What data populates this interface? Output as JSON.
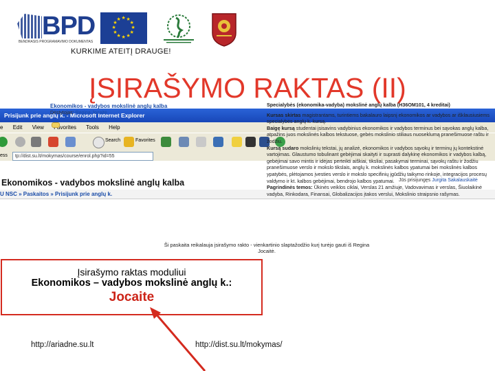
{
  "logos": {
    "bpd_text": "BPD",
    "bpd_subtitle": "BENDRASIS PROGRAMAVIMO DOKUMENTAS",
    "eu_name": "eu-flag",
    "esf_name": "esf-logo",
    "university_name": "university-crest"
  },
  "colors": {
    "title": "#e2382a",
    "callout_border": "#d42a1e",
    "link": "#1a4ca8",
    "xp_title": "#2a63d7"
  },
  "motto": "KURKIME   ATEITĮ   DRAUGE!",
  "title": "ĮSIRAŠYMO RAKTAS (II)",
  "browser": {
    "window_title": "Prisijunk prie anglų k. - Microsoft Internet Explorer",
    "menu": [
      "e",
      "Edit",
      "View",
      "Favorites",
      "Tools",
      "Help"
    ],
    "toolbar": {
      "search_label": "Search",
      "favorites_label": "Favorites"
    },
    "address": "tp://dist.su.lt/mokymas/course/enrol.php?id=55",
    "address_label": "ess",
    "page_heading": "Ekonomikos - vadybos mokslinė anglų kalba",
    "login_text": "Jūs prisijungęs",
    "login_user": "Jurgita Sakalauskaitė",
    "breadcrumbs": "U NSC » Paskaitos » Prisijunk prie anglų k.",
    "course_title": "Ekonomikos - vadybos mokslinė anglų kalba",
    "lecturer_label": "Dėstytojas:",
    "lecturer_name": "Regina Jocaitė",
    "description": {
      "heading": "Specialybės (ekonomika-vadyba) mokslinė anglų kalba (H36OM101, 4 kreditai)",
      "p1_label": "Kursas skirtas",
      "p1": "magistrantams, turintiems bakalauro laipsnį ekonomikos ar vadybos ar išklausiusiems specialybės anglų k. kursą.",
      "p2_label": "Baigę kursą",
      "p2": "studentai įsisavins vadybinius ekonomikos ir vadybos terminus bei sąvokas anglų kalba, atpažins juos mokslinės kalbos tekstuose, gebės mokslinio stiliaus nuoseklumą pranešimuose raštu ir žodžiu.",
      "p3_label": "Kursą sudaro",
      "p3": "mokslinių tekstai, jų analizė, ekonomikos ir vadybos sąvokų ir terminų jų kontekstinė vartojimas. Glaustumo tobulinant gebėjimai skaityti ir suprasti dalykinę ekonomikos ir vadybos kalbą, gebėjimai savo mintis ir idėjas perteikti aiškiai, tiksliai, pasakymai terminai, sąvokų raštu ir žodžiu pranešimuose verslo ir mokslo tikslais, anglų k. mokslinės kalbos ypatumai bei mokslinės kalbos ypatybės, plėtojamos įvesties verslo ir mokslo specifinių įgūdžių taikymo rinkoje, integracijos procesų valdymo ir kt. kalbos gebėjimai, bendrojo kalbos ypatumai.",
      "p4_label": "Pagrindinės temos:",
      "p4": "Ūkinės veiklos ciklai, Verslas 21 amžiuje, Vadovavimas ir verslas, Šiuolaikinė vadyba, Rinkodara, Finansai, Globalizacijos įtakos verslui, Mokslinio straipsnio rašymas."
    },
    "notice": "Ši paskaita reikalauja įsirašymo rakto - vienkartinio slaptažodžio kurį turėjo gauti iš Regina Jocaitė."
  },
  "callout": {
    "line1": "Įsirašymo raktas moduliui",
    "line2": "Ekonomikos – vadybos mokslinė anglų k.:",
    "key": "Jocaite"
  },
  "urls": {
    "left": "http://ariadne.su.lt",
    "right": "http://dist.su.lt/mokymas/"
  }
}
